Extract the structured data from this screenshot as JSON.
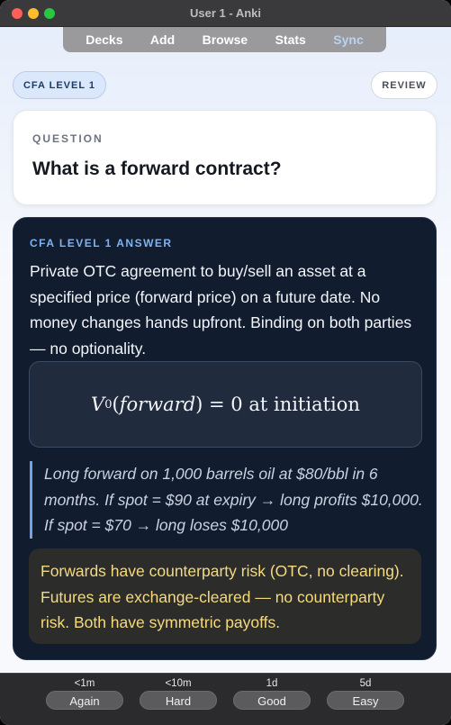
{
  "window": {
    "title": "User 1 - Anki"
  },
  "toolbar": {
    "tabs": [
      {
        "label": "Decks"
      },
      {
        "label": "Add"
      },
      {
        "label": "Browse"
      },
      {
        "label": "Stats"
      },
      {
        "label": "Sync"
      }
    ]
  },
  "deck": {
    "tag": "CFA LEVEL 1",
    "mode_button": "REVIEW"
  },
  "question": {
    "label": "QUESTION",
    "text": "What is a forward contract?"
  },
  "answer": {
    "label": "CFA LEVEL 1 ANSWER",
    "body": "Private OTC agreement to buy/sell an asset at a specified price (forward price) on a future date. No money changes hands upfront. Binding on both parties — no optionality.",
    "formula": {
      "lhs_symbol": "V",
      "lhs_subscript": "0",
      "lhs_argument": "forward",
      "rhs_value": "0",
      "rhs_text": "at initiation"
    },
    "example": "Long forward on 1,000 barrels oil at $80/bbl in 6 months. If spot = $90 at expiry → long profits $10,000. If spot = $70 → long loses $10,000",
    "note": "Forwards have counterparty risk (OTC, no clearing). Futures are exchange-cleared — no counterparty risk. Both have symmetric payoffs."
  },
  "ease_buttons": [
    {
      "interval": "<1m",
      "label": "Again"
    },
    {
      "interval": "<10m",
      "label": "Hard"
    },
    {
      "interval": "1d",
      "label": "Good"
    },
    {
      "interval": "5d",
      "label": "Easy"
    }
  ],
  "colors": {
    "answer_bg": "#111c2f",
    "accent_blue": "#7fb2f0",
    "note_text": "#f5da7d",
    "sync_tab": "#b9d2ee"
  }
}
